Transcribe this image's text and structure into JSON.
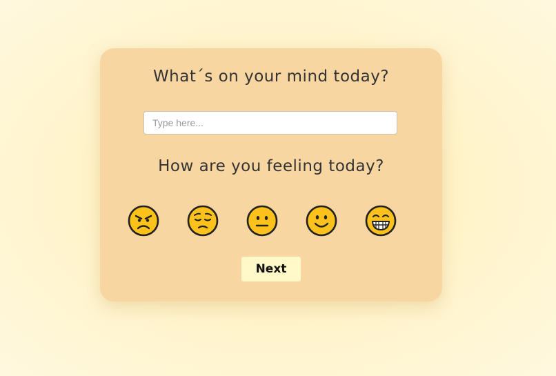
{
  "form": {
    "question_mind": "What´s on your mind today?",
    "input_placeholder": "Type here...",
    "input_value": "",
    "question_feeling": "How are you feeling today?",
    "moods": [
      {
        "name": "angry-emoji-icon"
      },
      {
        "name": "sad-emoji-icon"
      },
      {
        "name": "neutral-emoji-icon"
      },
      {
        "name": "slight-smile-emoji-icon"
      },
      {
        "name": "grin-emoji-icon"
      }
    ],
    "next_label": "Next"
  },
  "colors": {
    "page_background": "#fff3c8",
    "card_background": "#f8d6a2",
    "button_background": "#fff8c8",
    "emoji_yellow": "#fcc21b"
  }
}
